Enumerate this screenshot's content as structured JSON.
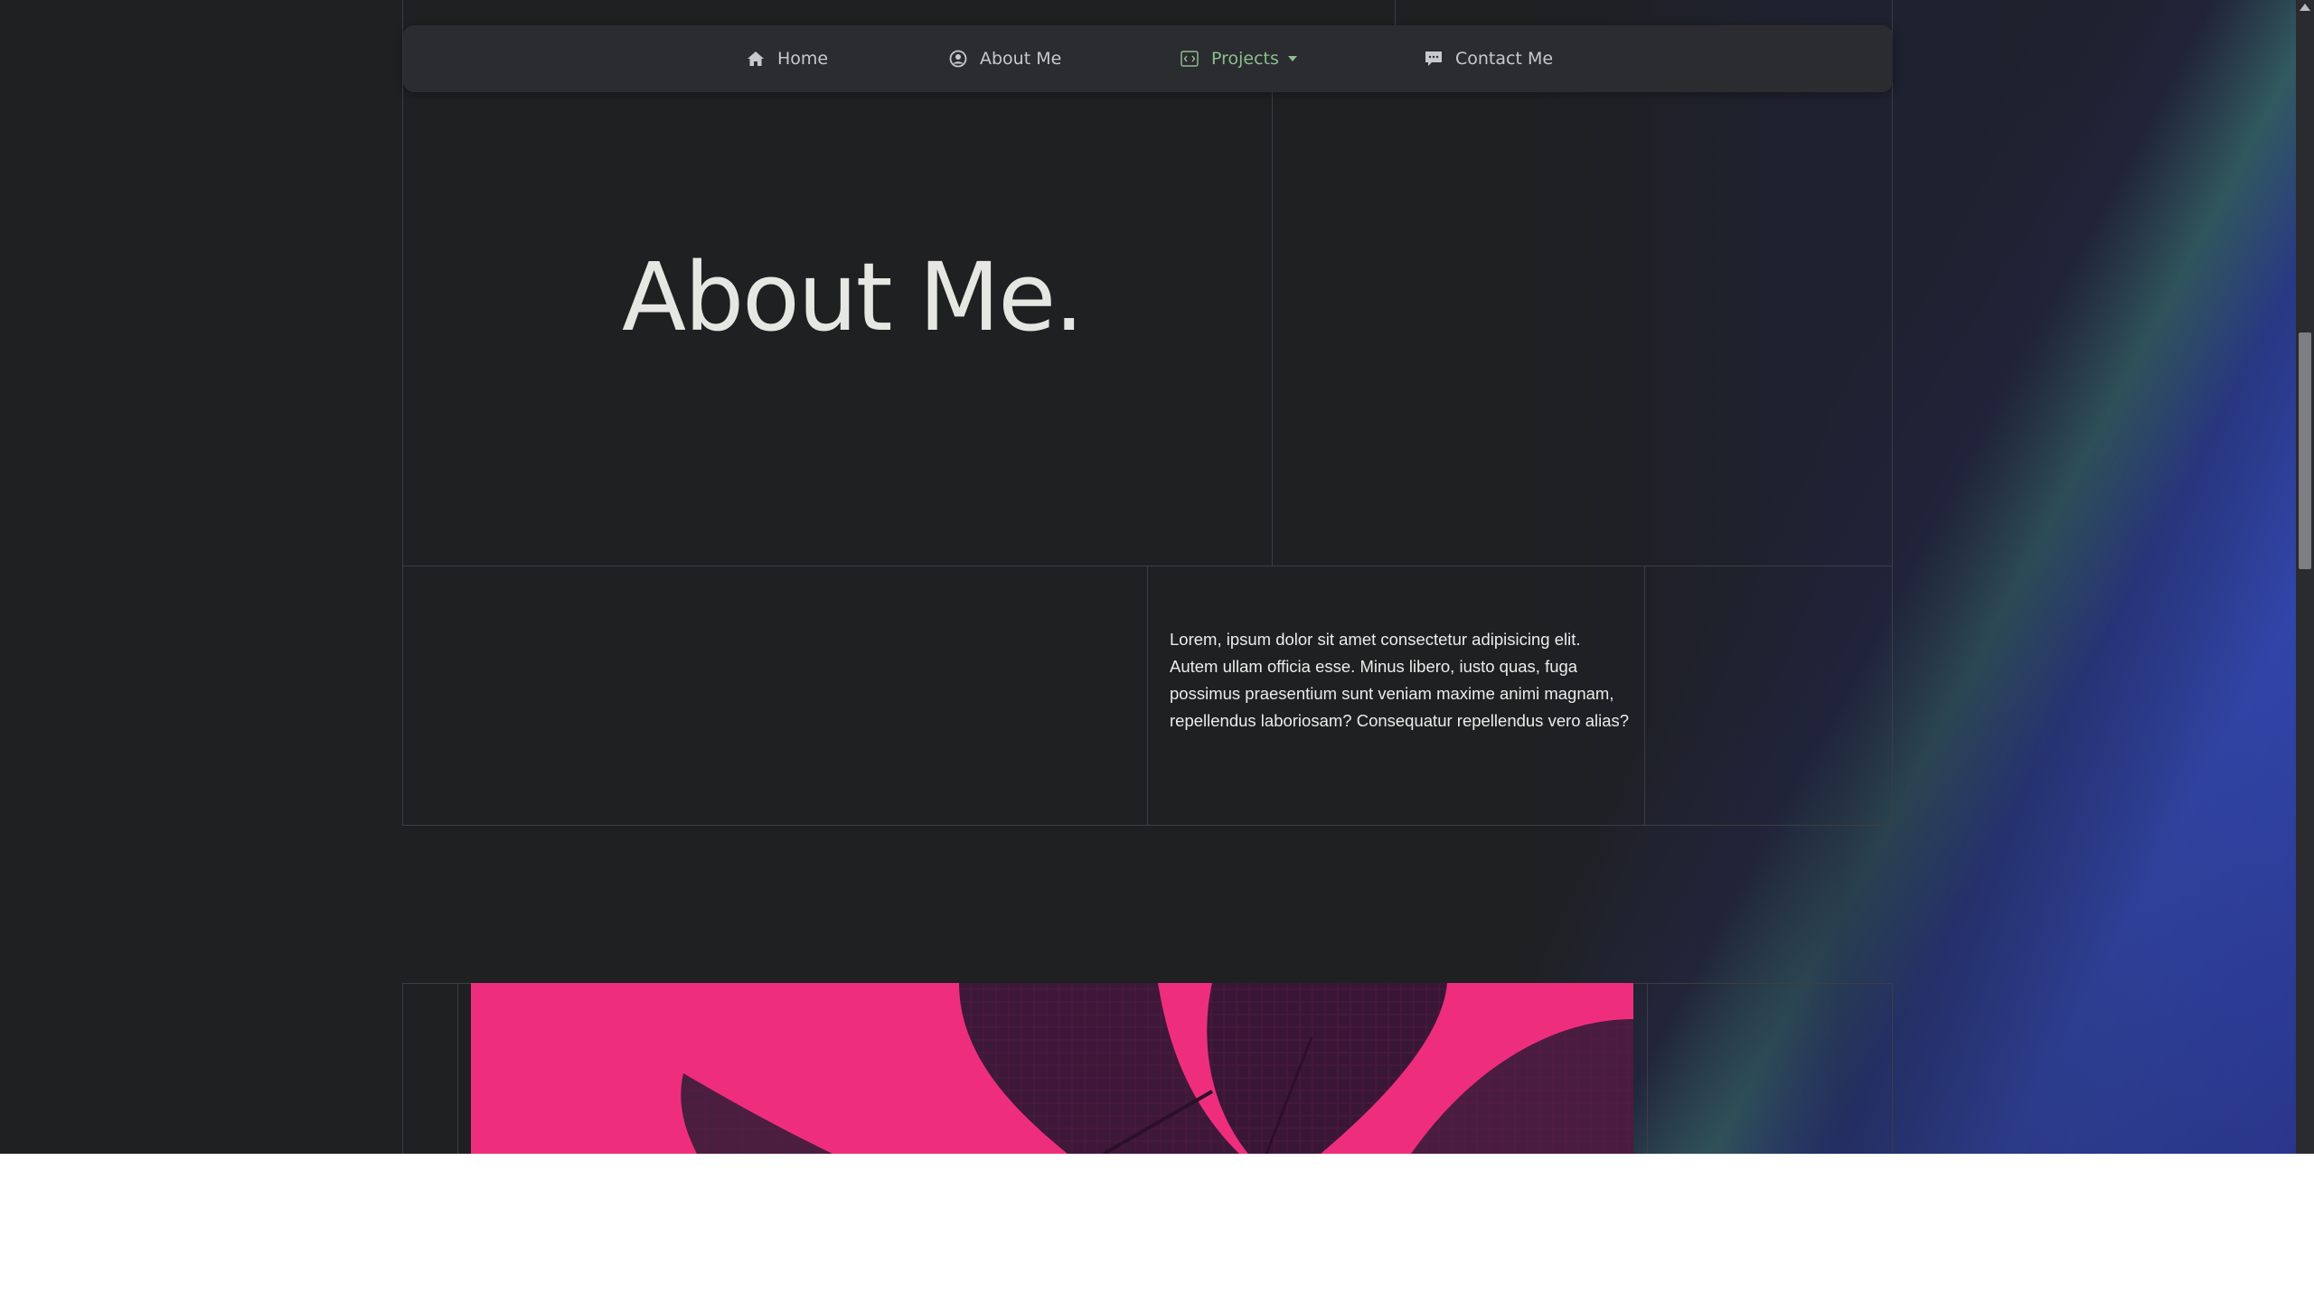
{
  "nav": {
    "items": [
      {
        "label": "Home",
        "icon": "home-icon"
      },
      {
        "label": "About Me",
        "icon": "user-circle-icon"
      },
      {
        "label": "Projects",
        "icon": "code-icon",
        "dropdown": true
      },
      {
        "label": "Contact Me",
        "icon": "chat-icon"
      }
    ],
    "active_color": "#8fbc8f"
  },
  "hero": {
    "title": "About Me."
  },
  "about": {
    "text": "Lorem, ipsum dolor sit amet consectetur adipisicing elit. Autem ullam officia esse. Minus libero, iusto quas, fuga possimus praesentium sunt veniam maxime animi magnam, repellendus laboriosam? Consequatur repellendus vero alias?"
  },
  "colors": {
    "background": "#1f2022",
    "accent_pink": "#ee2e7d",
    "glow_blue": "#3a50c8",
    "glow_teal": "#3c7878"
  }
}
